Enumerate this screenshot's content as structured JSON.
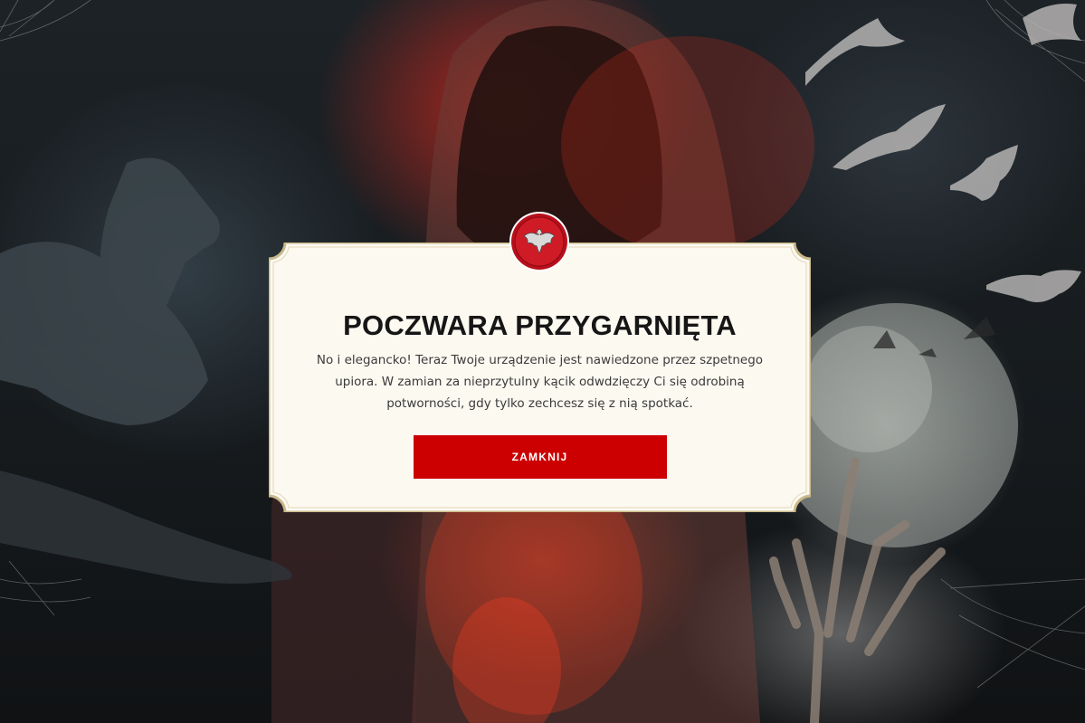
{
  "modal": {
    "title": "POCZWARA PRZYGARNIĘTA",
    "body": "No i elegancko! Teraz Twoje urządzenie jest nawiedzone przez szpetnego upiora. W zamian za nieprzytulny kącik odwdzięczy Ci się odrobiną potworności, gdy tylko zechcesz się z nią spotkać.",
    "close_label": "ZAMKNIJ",
    "logo_icon": "bat-logo-icon"
  },
  "colors": {
    "accent": "#cc0000",
    "modal_background": "#fcf9f1",
    "modal_border": "#c9b98a",
    "title": "#161616",
    "text": "#3a3a3a"
  },
  "background": {
    "theme": "halloween",
    "elements": [
      "hooded-ghost",
      "bats",
      "cobwebs",
      "moon",
      "skeleton-hand",
      "red-smoke"
    ]
  }
}
